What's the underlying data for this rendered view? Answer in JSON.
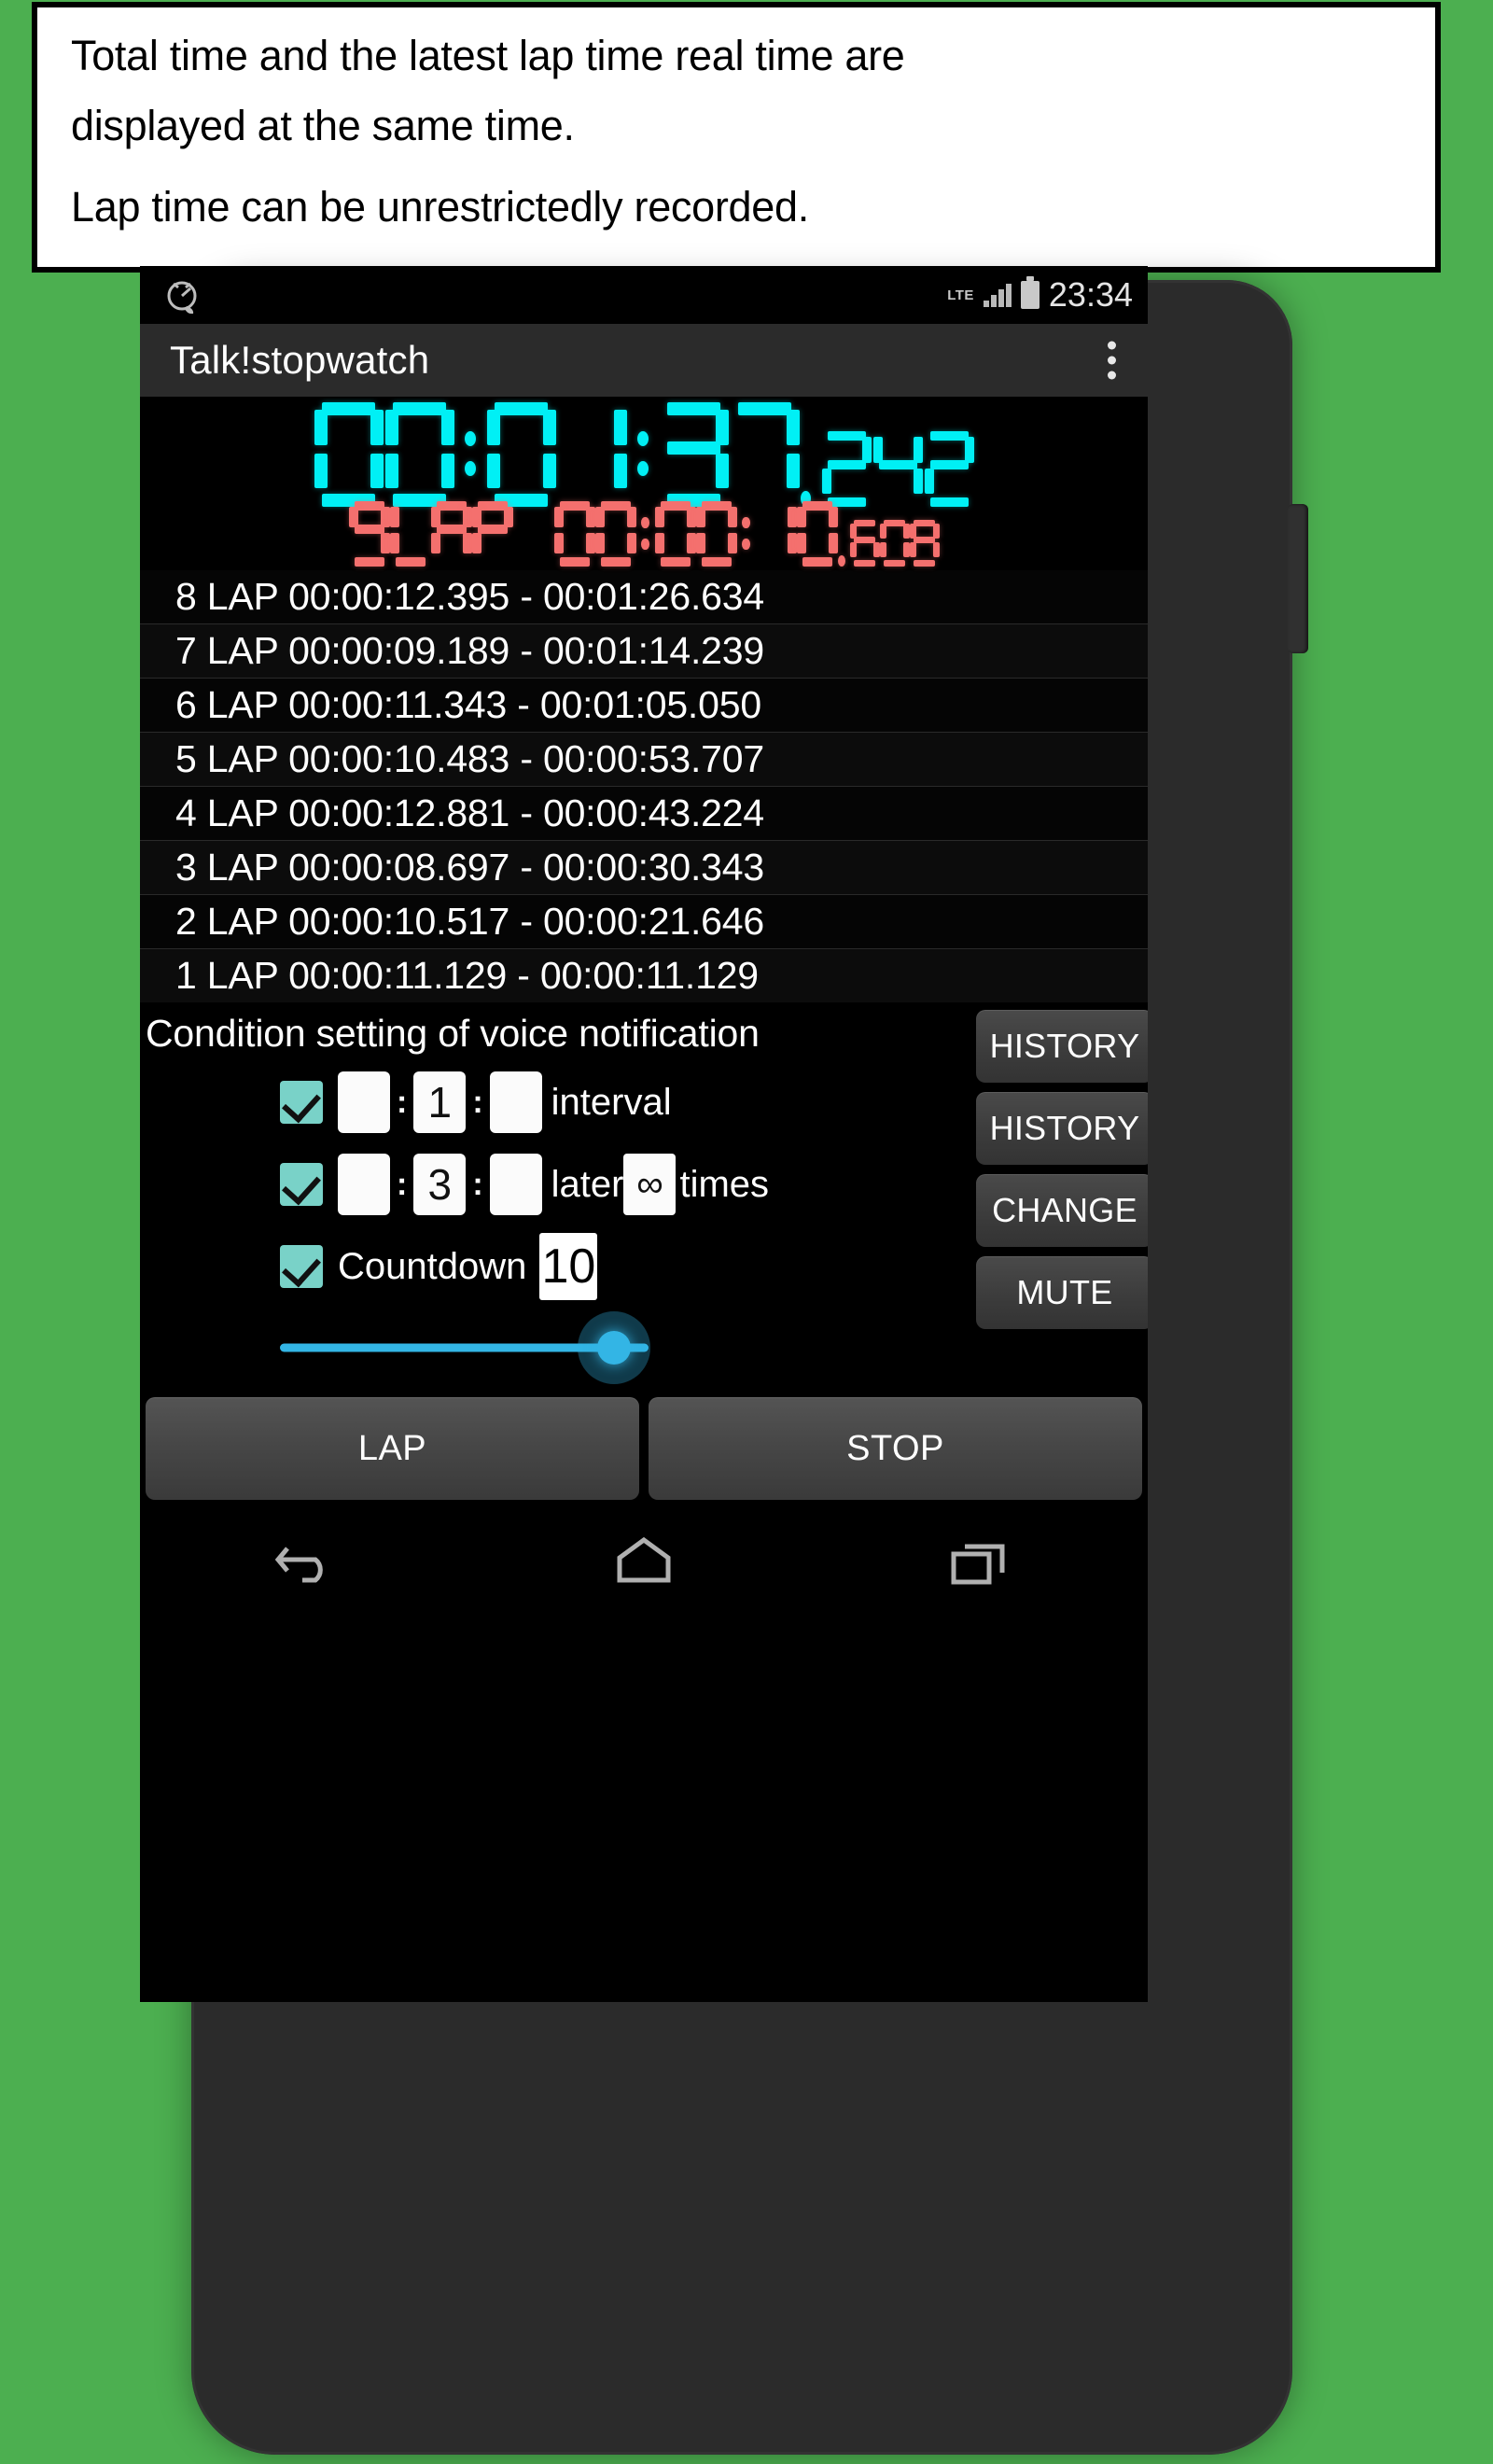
{
  "caption": {
    "line1": "Total time and the latest lap time real time are",
    "line2": "displayed at the same time.",
    "line3": "Lap time can be unrestrictedly recorded."
  },
  "colors": {
    "background_green": "#4CAF50",
    "lcd_cyan": "#00F0F5",
    "lcd_red": "#F4706E",
    "checkbox_teal": "#79D2C8",
    "slider_blue": "#33B5E5",
    "device_body": "#2B2B2B"
  },
  "status_bar": {
    "app_icon": "stopwatch-icon",
    "network_label": "LTE",
    "signal_icon": "signal-bars-icon",
    "battery_icon": "battery-full-icon",
    "clock": "23:34"
  },
  "action_bar": {
    "title": "Talk!stopwatch",
    "overflow_icon": "overflow-menu-icon"
  },
  "lcd": {
    "total_time": "00:01:37.242",
    "total_time_digits": "00:01:37",
    "total_time_millis": "242",
    "lap_label": "9 LAP",
    "lap_time": "00:00:10.608",
    "lap_time_digits": "00:00:10",
    "lap_time_millis": "608"
  },
  "laps": [
    {
      "num": "8 LAP",
      "split": "00:00:12.395",
      "total": "00:01:26.634",
      "text": "8 LAP 00:00:12.395 - 00:01:26.634"
    },
    {
      "num": "7 LAP",
      "split": "00:00:09.189",
      "total": "00:01:14.239",
      "text": "7 LAP 00:00:09.189 - 00:01:14.239"
    },
    {
      "num": "6 LAP",
      "split": "00:00:11.343",
      "total": "00:01:05.050",
      "text": "6 LAP 00:00:11.343 - 00:01:05.050"
    },
    {
      "num": "5 LAP",
      "split": "00:00:10.483",
      "total": "00:00:53.707",
      "text": "5 LAP 00:00:10.483 - 00:00:53.707"
    },
    {
      "num": "4 LAP",
      "split": "00:00:12.881",
      "total": "00:00:43.224",
      "text": "4 LAP 00:00:12.881 - 00:00:43.224"
    },
    {
      "num": "3 LAP",
      "split": "00:00:08.697",
      "total": "00:00:30.343",
      "text": "3 LAP 00:00:08.697 - 00:00:30.343"
    },
    {
      "num": "2 LAP",
      "split": "00:00:10.517",
      "total": "00:00:21.646",
      "text": "2 LAP 00:00:10.517 - 00:00:21.646"
    },
    {
      "num": "1 LAP",
      "split": "00:00:11.129",
      "total": "00:00:11.129",
      "text": "1 LAP 00:00:11.129 - 00:00:11.129"
    }
  ],
  "settings": {
    "title": "Condition setting of voice notification",
    "interval_row": {
      "checked": true,
      "hours": "",
      "minutes": "1",
      "seconds": "",
      "sep": ":",
      "label": "interval",
      "button": "HISTORY"
    },
    "later_row": {
      "checked": true,
      "hours": "",
      "minutes": "3",
      "seconds": "",
      "sep": ":",
      "label_before": "later",
      "times_value": "∞",
      "label_after": "times",
      "button": "HISTORY"
    },
    "countdown_row": {
      "checked": true,
      "label": "Countdown",
      "value": "10",
      "button": "CHANGE"
    },
    "volume_row": {
      "button": "MUTE",
      "slider_percent": 100
    }
  },
  "main_buttons": {
    "lap": "LAP",
    "stop": "STOP"
  },
  "nav_bar": {
    "back": "back-icon",
    "home": "home-icon",
    "recents": "recents-icon"
  }
}
